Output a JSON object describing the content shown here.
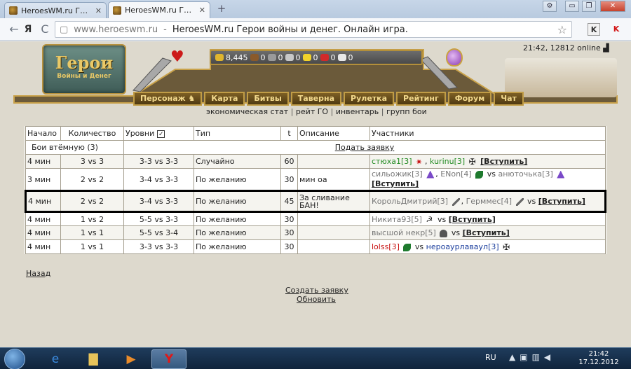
{
  "browser": {
    "tabs": [
      {
        "label": "HeroesWM.ru Герои в"
      },
      {
        "label": "HeroesWM.ru Герои в"
      }
    ],
    "new_tab": "+",
    "window_buttons": {
      "settings": "⚙",
      "minimize": "▭",
      "restore": "❐",
      "close": "✕"
    },
    "nav": {
      "back": "←",
      "forward": "→",
      "yandex": "Я",
      "reload": "C"
    },
    "address": {
      "host": "www.heroeswm.ru",
      "separator": "-",
      "title": "HeroesWM.ru Герои войны и денег. Онлайн игра."
    },
    "star": "☆",
    "ext_k": "K",
    "ext_yandex": "K"
  },
  "site": {
    "logo_title": "Герои",
    "logo_subtitle": "Войны и Денег",
    "server_time": "21:42, 12812 online",
    "resources": [
      {
        "icon": "gold-icon",
        "value": "8,445",
        "color": "#e0b52d"
      },
      {
        "icon": "wood-icon",
        "value": "0",
        "color": "#8a5a2b"
      },
      {
        "icon": "ore-icon",
        "value": "0",
        "color": "#9a9a9a"
      },
      {
        "icon": "mercury-icon",
        "value": "0",
        "color": "#c8c8c8"
      },
      {
        "icon": "sulfur-icon",
        "value": "0",
        "color": "#f2d22a"
      },
      {
        "icon": "crystals-icon",
        "value": "0",
        "color": "#d22a2a"
      },
      {
        "icon": "gems-icon",
        "value": "0",
        "color": "#e8e8e8"
      }
    ],
    "nav": [
      {
        "label": "Персонаж",
        "icon": "character-icon"
      },
      {
        "label": "Карта"
      },
      {
        "label": "Битвы"
      },
      {
        "label": "Таверна"
      },
      {
        "label": "Рулетка"
      },
      {
        "label": "Рейтинг"
      },
      {
        "label": "Форум"
      },
      {
        "label": "Чат"
      }
    ],
    "subnav": [
      "экономическая стат",
      "рейт ГО",
      "инвентарь",
      "групп бои"
    ]
  },
  "battles": {
    "headers": {
      "start": "Начало",
      "count": "Количество",
      "levels": "Уровни",
      "type": "Тип",
      "t": "t",
      "desc": "Описание",
      "participants": "Участники"
    },
    "levels_checked": "✓",
    "group_title": "Бои втёмную (3)",
    "submit_link": "Подать заявку",
    "join": "[Вступить]",
    "vs": "vs",
    "rows": [
      {
        "start": "4 мин",
        "count": "3 vs 3",
        "levels": "3-3 vs 3-3",
        "type": "Случайно",
        "t": "60",
        "desc": "",
        "p1": "стюха1[3]",
        "p2": "kurinu[3]"
      },
      {
        "start": "3 мин",
        "count": "2 vs 2",
        "levels": "3-4 vs 3-3",
        "type": "По желанию",
        "t": "30",
        "desc": "мин оа",
        "p1": "сильожик[3]",
        "p2": "ENon[4]",
        "p3": "анюточька[3]"
      },
      {
        "start": "4 мин",
        "count": "2 vs 2",
        "levels": "3-4 vs 3-3",
        "type": "По желанию",
        "t": "45",
        "desc": "За сливание БАН!",
        "p1": "КорольДмитрий[3]",
        "p2": "Герммес[4]"
      },
      {
        "start": "4 мин",
        "count": "1 vs 2",
        "levels": "5-5 vs 3-3",
        "type": "По желанию",
        "t": "30",
        "desc": "",
        "p1": "Никита93[5]"
      },
      {
        "start": "4 мин",
        "count": "1 vs 1",
        "levels": "5-5 vs 3-4",
        "type": "По желанию",
        "t": "30",
        "desc": "",
        "p1": "высшой некр[5]"
      },
      {
        "start": "4 мин",
        "count": "1 vs 1",
        "levels": "3-3 vs 3-3",
        "type": "По желанию",
        "t": "30",
        "desc": "",
        "p1": "lolss[3]",
        "p2": "нероаурлаваул[3]"
      }
    ]
  },
  "links": {
    "back": "Назад",
    "create": "Создать заявку",
    "refresh": "Обновить"
  },
  "taskbar": {
    "lang": "RU",
    "time": "21:42",
    "date": "17.12.2012"
  }
}
